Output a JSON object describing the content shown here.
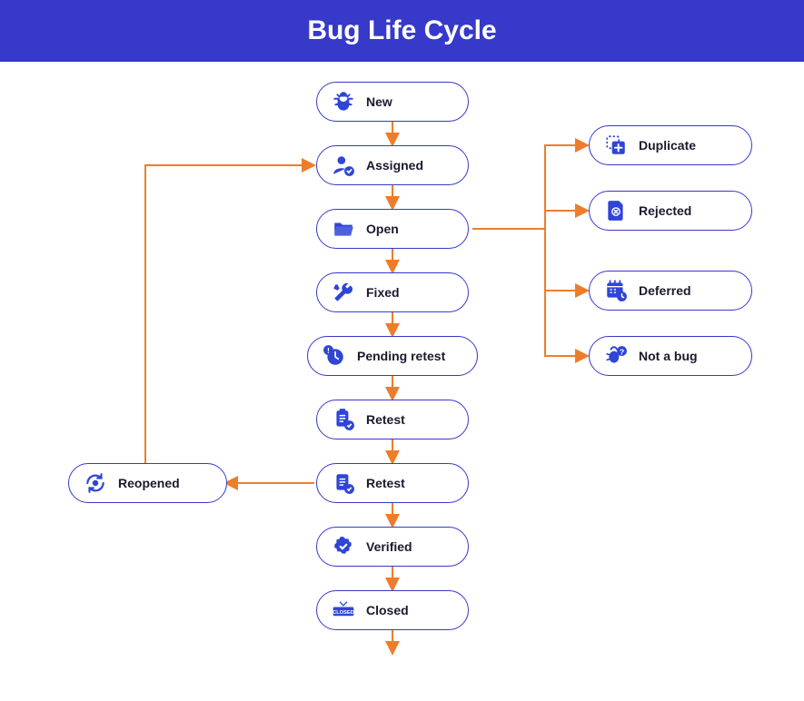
{
  "header": {
    "title": "Bug Life Cycle"
  },
  "nodes": {
    "new": {
      "label": "New"
    },
    "assigned": {
      "label": "Assigned"
    },
    "open": {
      "label": "Open"
    },
    "fixed": {
      "label": "Fixed"
    },
    "pending": {
      "label": "Pending retest"
    },
    "retest": {
      "label": "Retest"
    },
    "verified": {
      "label": "Verified"
    },
    "closed": {
      "label": "Closed"
    },
    "reopened": {
      "label": "Reopened"
    },
    "duplicate": {
      "label": "Duplicate"
    },
    "rejected": {
      "label": "Rejected"
    },
    "deferred": {
      "label": "Deferred"
    },
    "notabug": {
      "label": "Not a bug"
    }
  },
  "colors": {
    "header_bg": "#3639c9",
    "node_border": "#3639c9",
    "icon_fill": "#2f45d6",
    "arrow": "#ed7d2b"
  },
  "flow": {
    "main_sequence": [
      "new",
      "assigned",
      "open",
      "fixed",
      "pending",
      "retest",
      "verified",
      "closed"
    ],
    "branches_from_open": [
      "duplicate",
      "rejected",
      "deferred",
      "notabug"
    ],
    "retest_to": "reopened",
    "reopened_to": "assigned"
  }
}
